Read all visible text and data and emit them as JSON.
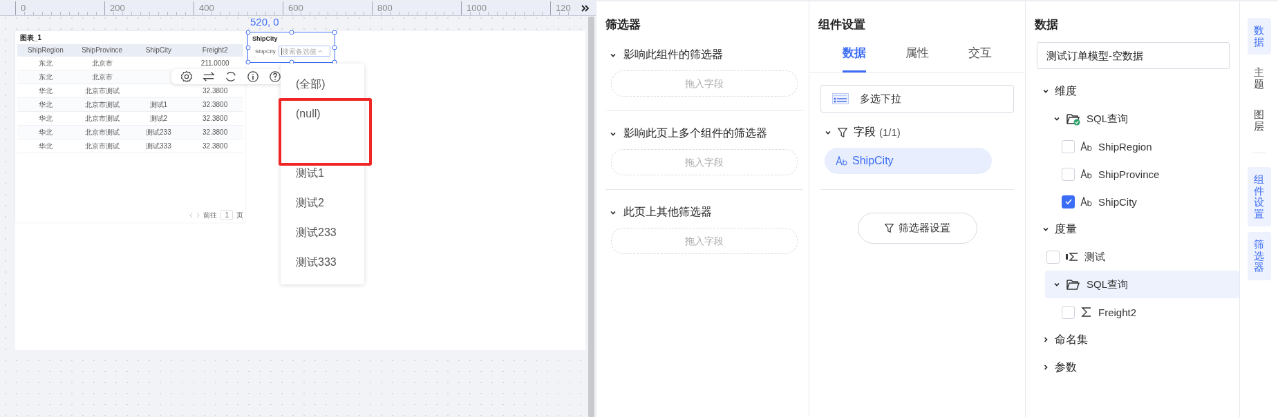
{
  "canvas": {
    "ruler_labels": [
      "0",
      "200",
      "400",
      "600",
      "800",
      "1000",
      "120"
    ],
    "position_label": "520, 0",
    "table_widget": {
      "title": "图表_1",
      "columns": [
        "ShipRegion",
        "ShipProvince",
        "ShipCity",
        "Freight2"
      ],
      "rows": [
        [
          "东北",
          "北京市",
          null,
          "211.0000"
        ],
        [
          "东北",
          "北京市",
          null,
          null
        ],
        [
          "华北",
          "北京市测试",
          null,
          "32.3800"
        ],
        [
          "华北",
          "北京市测试",
          "测试1",
          "32.3800"
        ],
        [
          "华北",
          "北京市测试",
          "测试2",
          "32.3800"
        ],
        [
          "华北",
          "北京市测试",
          "测试233",
          "32.3800"
        ],
        [
          "华北",
          "北京市测试",
          "测试333",
          "32.3800"
        ]
      ],
      "pagination": {
        "goto": "前往",
        "page": "1",
        "unit": "页"
      }
    },
    "filter_widget": {
      "title": "ShipCity",
      "label": "ShipCity",
      "placeholder": "搜索备选值",
      "expanded": true
    },
    "dropdown": {
      "items": [
        {
          "kind": "option",
          "label": "(全部)"
        },
        {
          "kind": "option",
          "label": "(null)"
        },
        {
          "kind": "empty"
        },
        {
          "kind": "option",
          "label": "测试1"
        },
        {
          "kind": "option",
          "label": "测试2"
        },
        {
          "kind": "option",
          "label": "测试233"
        },
        {
          "kind": "option",
          "label": "测试333"
        }
      ]
    }
  },
  "filter_panel": {
    "title": "筛选器",
    "sections": [
      {
        "title": "影响此组件的筛选器",
        "expanded": true,
        "drop_zone": "拖入字段"
      },
      {
        "title": "影响此页上多个组件的筛选器",
        "expanded": true,
        "drop_zone": "拖入字段"
      },
      {
        "title": "此页上其他筛选器",
        "expanded": true,
        "drop_zone": "拖入字段"
      }
    ]
  },
  "settings_panel": {
    "title": "组件设置",
    "tabs": [
      {
        "label": "数据",
        "selected": true
      },
      {
        "label": "属性",
        "selected": false
      },
      {
        "label": "交互",
        "selected": false
      }
    ],
    "component_type": "多选下拉",
    "fields_section": {
      "title": "字段",
      "count": "(1/1)",
      "expanded": true
    },
    "fields": [
      "ShipCity"
    ],
    "filter_settings_button": "筛选器设置"
  },
  "data_panel": {
    "title": "数据",
    "model": "测试订单模型-空数据",
    "tree": [
      {
        "kind": "group",
        "label": "维度",
        "expanded": true,
        "children": [
          {
            "kind": "folder",
            "label": "SQL查询",
            "expanded": true,
            "linked": true,
            "selected": false,
            "children": [
              {
                "kind": "text_field",
                "label": "ShipRegion",
                "checked": false
              },
              {
                "kind": "text_field",
                "label": "ShipProvince",
                "checked": false
              },
              {
                "kind": "text_field",
                "label": "ShipCity",
                "checked": true
              }
            ]
          }
        ]
      },
      {
        "kind": "group",
        "label": "度量",
        "expanded": true,
        "children": [
          {
            "kind": "calc_field",
            "label": "测试",
            "checked": false
          },
          {
            "kind": "folder",
            "label": "SQL查询",
            "expanded": true,
            "linked": false,
            "selected": true,
            "children": [
              {
                "kind": "measure_field",
                "label": "Freight2",
                "checked": false
              }
            ]
          }
        ]
      },
      {
        "kind": "group",
        "label": "命名集",
        "expanded": false
      },
      {
        "kind": "group",
        "label": "参数",
        "expanded": false
      }
    ]
  },
  "side_tabs": [
    {
      "label": "数据",
      "open": true
    },
    {
      "label": "主题",
      "open": false
    },
    {
      "label": "图层",
      "open": false,
      "divider_after": true
    },
    {
      "label": "组件设置",
      "open": true
    },
    {
      "label": "筛选器",
      "open": true
    }
  ]
}
